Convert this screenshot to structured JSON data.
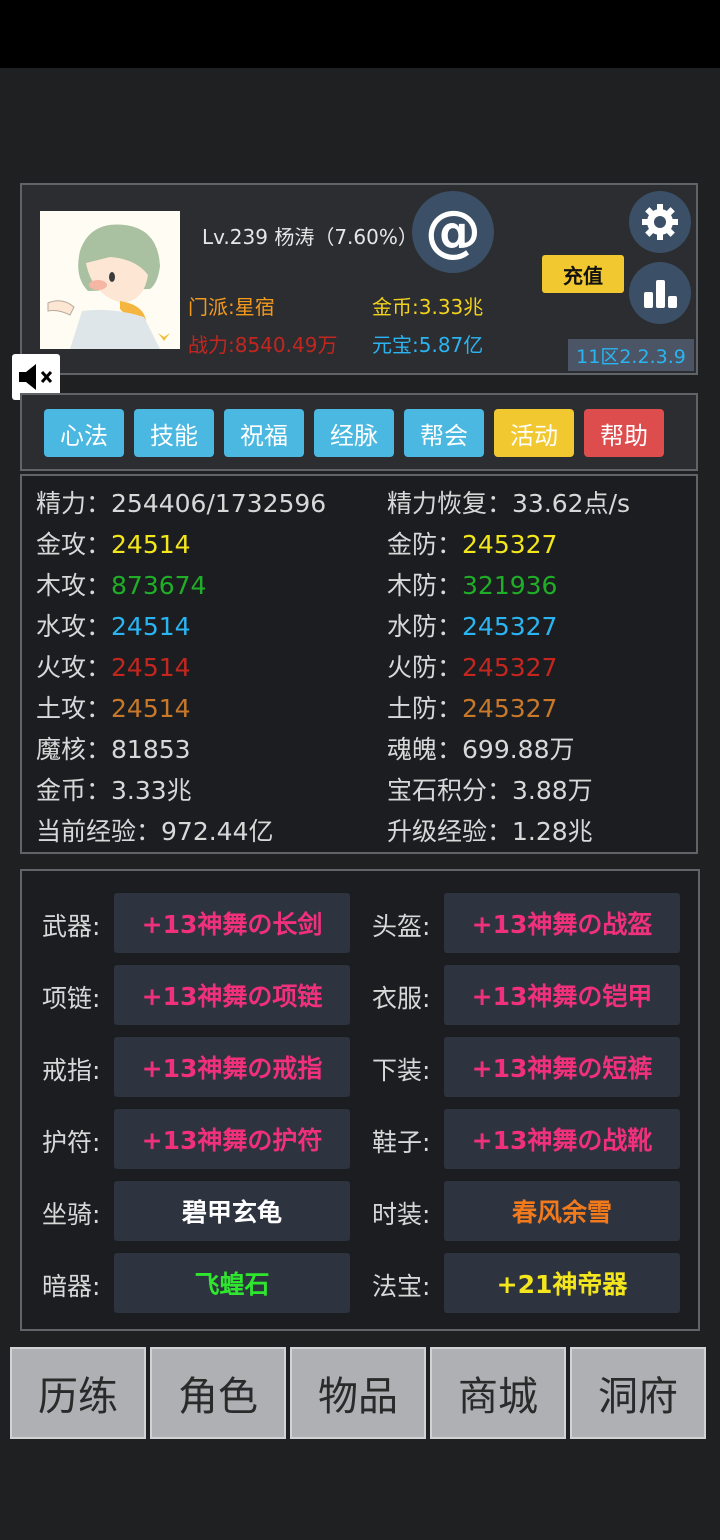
{
  "player": {
    "level_line": "Lv.239 杨涛（7.60%）",
    "sect": "门派:星宿",
    "power": "战力:8540.49万",
    "gold": "金币:3.33兆",
    "yuanbao": "元宝:5.87亿",
    "recharge_label": "充值",
    "server": "11区2.2.3.9",
    "at_icon": "@"
  },
  "tabs": [
    {
      "label": "心法",
      "color": "#4ab8e0"
    },
    {
      "label": "技能",
      "color": "#4ab8e0"
    },
    {
      "label": "祝福",
      "color": "#4ab8e0"
    },
    {
      "label": "经脉",
      "color": "#4ab8e0"
    },
    {
      "label": "帮会",
      "color": "#4ab8e0"
    },
    {
      "label": "活动",
      "color": "#f2c830"
    },
    {
      "label": "帮助",
      "color": "#de4d4d"
    }
  ],
  "stats": {
    "rows": [
      {
        "l_label": "精力：",
        "l_value": "254406/1732596",
        "l_color": "#d8d8d8",
        "r_label": "精力恢复：",
        "r_value": "33.62点/s",
        "r_color": "#d8d8d8"
      },
      {
        "l_label": "金攻：",
        "l_value": "24514",
        "l_color": "#f3e61c",
        "r_label": "金防：",
        "r_value": "245327",
        "r_color": "#f3e61c"
      },
      {
        "l_label": "木攻：",
        "l_value": "873674",
        "l_color": "#1fae27",
        "r_label": "木防：",
        "r_value": "321936",
        "r_color": "#1fae27"
      },
      {
        "l_label": "水攻：",
        "l_value": "24514",
        "l_color": "#2ab5f2",
        "r_label": "水防：",
        "r_value": "245327",
        "r_color": "#2ab5f2"
      },
      {
        "l_label": "火攻：",
        "l_value": "24514",
        "l_color": "#c3261f",
        "r_label": "火防：",
        "r_value": "245327",
        "r_color": "#c3261f"
      },
      {
        "l_label": "土攻：",
        "l_value": "24514",
        "l_color": "#c8782a",
        "r_label": "土防：",
        "r_value": "245327",
        "r_color": "#c8782a"
      },
      {
        "l_label": "魔核：",
        "l_value": "81853",
        "l_color": "#d8d8d8",
        "r_label": "魂魄：",
        "r_value": "699.88万",
        "r_color": "#d8d8d8"
      },
      {
        "l_label": "金币：",
        "l_value": "3.33兆",
        "l_color": "#d8d8d8",
        "r_label": "宝石积分：",
        "r_value": "3.88万",
        "r_color": "#d8d8d8"
      },
      {
        "l_label": "当前经验：",
        "l_value": "972.44亿",
        "l_color": "#d8d8d8",
        "r_label": "升级经验：",
        "r_value": "1.28兆",
        "r_color": "#d8d8d8"
      }
    ]
  },
  "equipment": [
    {
      "l_label": "武器:",
      "l_item": "+13神舞の长剑",
      "l_color": "#f0307a",
      "r_label": "头盔:",
      "r_item": "+13神舞の战盔",
      "r_color": "#f0307a"
    },
    {
      "l_label": "项链:",
      "l_item": "+13神舞の项链",
      "l_color": "#f0307a",
      "r_label": "衣服:",
      "r_item": "+13神舞の铠甲",
      "r_color": "#f0307a"
    },
    {
      "l_label": "戒指:",
      "l_item": "+13神舞の戒指",
      "l_color": "#f0307a",
      "r_label": "下装:",
      "r_item": "+13神舞の短裤",
      "r_color": "#f0307a"
    },
    {
      "l_label": "护符:",
      "l_item": "+13神舞の护符",
      "l_color": "#f0307a",
      "r_label": "鞋子:",
      "r_item": "+13神舞の战靴",
      "r_color": "#f0307a"
    },
    {
      "l_label": "坐骑:",
      "l_item": "碧甲玄龟",
      "l_color": "#ffffff",
      "r_label": "时装:",
      "r_item": "春风余雪",
      "r_color": "#f07a1c"
    },
    {
      "l_label": "暗器:",
      "l_item": "飞蝗石",
      "l_color": "#2ee62e",
      "r_label": "法宝:",
      "r_item": "+21神帝器",
      "r_color": "#f3e61c"
    }
  ],
  "nav": [
    "历练",
    "角色",
    "物品",
    "商城",
    "洞府"
  ]
}
